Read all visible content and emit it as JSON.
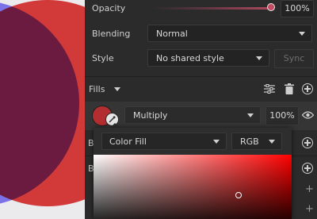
{
  "colors": {
    "panel_bg": "#2b2b2b",
    "accent": "#c24b62",
    "fill_swatch": "#b32e30"
  },
  "opacity": {
    "label": "Opacity",
    "value": "100%",
    "level": 1.0
  },
  "blending": {
    "label": "Blending",
    "value": "Normal"
  },
  "style": {
    "label": "Style",
    "value": "No shared style",
    "sync_label": "Sync"
  },
  "fills": {
    "label": "Fills",
    "icons": [
      "fills-chevron-icon",
      "sliders-icon",
      "trash-icon",
      "add-fill-icon"
    ],
    "row": {
      "blend_mode": "Multiply",
      "opacity": "100%"
    }
  },
  "color_popup": {
    "fill_type": "Color Fill",
    "color_model": "RGB"
  },
  "partial_rows": [
    "B",
    "B"
  ]
}
